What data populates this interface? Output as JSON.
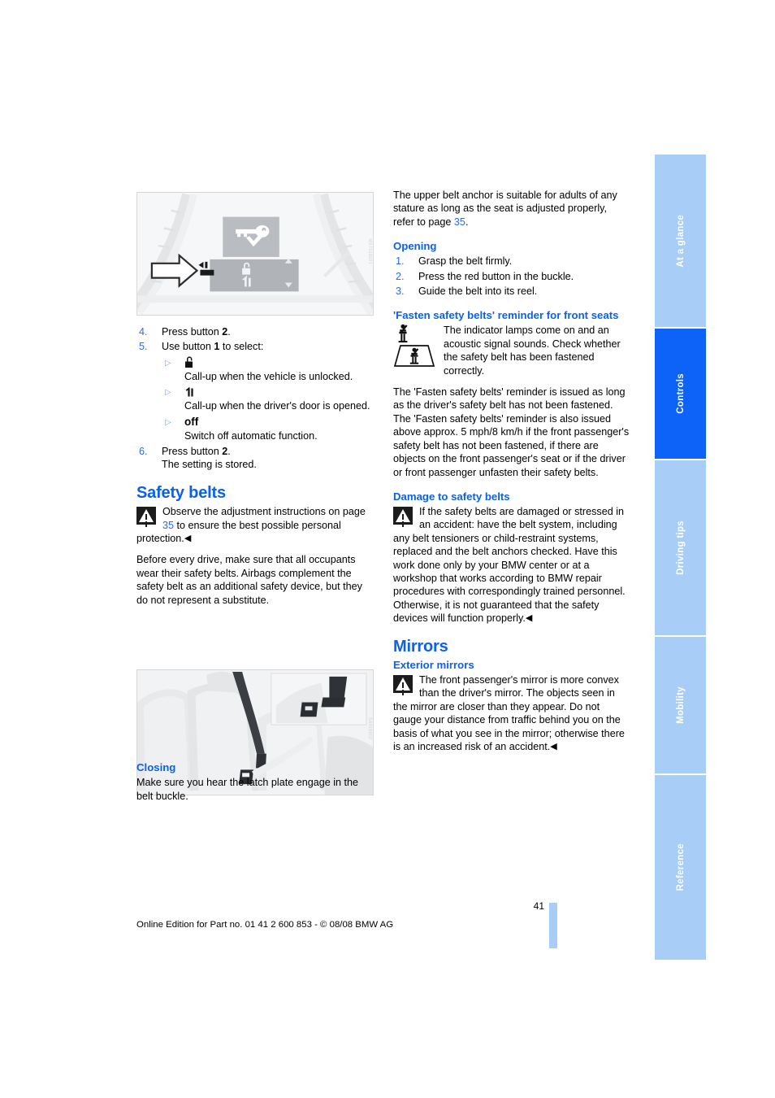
{
  "page": {
    "number": "41",
    "footer": "Online Edition for Part no. 01 41 2 600 853 - © 08/08 BMW AG"
  },
  "tabs": [
    {
      "label": "At a glance",
      "active": false
    },
    {
      "label": "Controls",
      "active": true
    },
    {
      "label": "Driving tips",
      "active": false
    },
    {
      "label": "Mobility",
      "active": false
    },
    {
      "label": "Reference",
      "active": false
    }
  ],
  "colors": {
    "heading_blue": "#0b61ee",
    "tab_inactive": "#a8cdf7",
    "tab_active": "#0d63f8",
    "list_number_blue": "#2b6cf0"
  },
  "left_column": {
    "figure_cluster": {
      "name": "instrument-cluster-display-figure",
      "alt": "Instrument cluster display showing key symbol with check mark and menu arrows, white arrow pointing to button"
    },
    "steps": [
      {
        "num": "4.",
        "text_before": "Press button ",
        "bold": "2",
        "text_after": "."
      },
      {
        "num": "5.",
        "text_before": "Use button ",
        "bold": "1",
        "text_after": " to select:"
      }
    ],
    "substeps": [
      {
        "glyph": "unlocked-padlock",
        "text": "Call-up when the vehicle is unlocked."
      },
      {
        "glyph": "open-door",
        "text": "Call-up when the driver's door is opened."
      },
      {
        "glyph": "off",
        "glyph_text": "off",
        "text": "Switch off automatic function."
      }
    ],
    "step6": {
      "num": "6.",
      "text_before": "Press button ",
      "bold": "2",
      "text_after": ".",
      "line2": "The setting is stored."
    },
    "safety_belts_heading": "Safety belts",
    "warning_1": {
      "part1": "Observe the adjustment instructions on page ",
      "page_ref": "35",
      "part2": " to ensure the best possible personal protection.",
      "endmark": "◀"
    },
    "body_1": "Before every drive, make sure that all occupants wear their safety belts. Airbags complement the safety belt as an additional safety device, but they do not represent a substitute.",
    "figure_belts": {
      "name": "safety-belt-seats-figure",
      "alt": "Front seats with safety belt fastened and inset detail of latch plate and buckle"
    },
    "closing_heading": "Closing",
    "closing_body": "Make sure you hear the latch plate engage in the belt buckle."
  },
  "right_column": {
    "intro": {
      "part1": "The upper belt anchor is suitable for adults of any stature as long as the seat is adjusted properly, refer to page ",
      "page_ref": "35",
      "part2": "."
    },
    "opening_heading": "Opening",
    "opening_steps": [
      {
        "num": "1.",
        "text": "Grasp the belt firmly."
      },
      {
        "num": "2.",
        "text": "Press the red button in the buckle."
      },
      {
        "num": "3.",
        "text": "Guide the belt into its reel."
      }
    ],
    "reminder_heading": "'Fasten safety belts' reminder for front seats",
    "reminder_note": "The indicator lamps come on and an acoustic signal sounds. Check whether the safety belt has been fastened correctly.",
    "reminder_body": "The 'Fasten safety belts' reminder is issued as long as the driver's safety belt has not been fastened. The 'Fasten safety belts' reminder is also issued above approx. 5 mph/8 km/h if the front passenger's safety belt has not been fastened, if there are objects on the front passenger's seat or if the driver or front passenger unfasten their safety belts.",
    "damage_heading": "Damage to safety belts",
    "damage_note": "If the safety belts are damaged or stressed in an accident: have the belt system, including any belt tensioners or child-restraint systems, replaced and the belt anchors checked. Have this work done only by your BMW center or at a workshop that works according to BMW repair procedures with correspondingly trained personnel. Otherwise, it is not guaranteed that the safety devices will function properly.",
    "damage_endmark": "◀",
    "mirrors_heading": "Mirrors",
    "exterior_heading": "Exterior mirrors",
    "exterior_note": "The front passenger's mirror is more convex than the driver's mirror. The objects seen in the mirror are closer than they appear. Do not gauge your distance from traffic behind you on the basis of what you see in the mirror; otherwise there is an increased risk of an accident.",
    "exterior_endmark": "◀"
  }
}
